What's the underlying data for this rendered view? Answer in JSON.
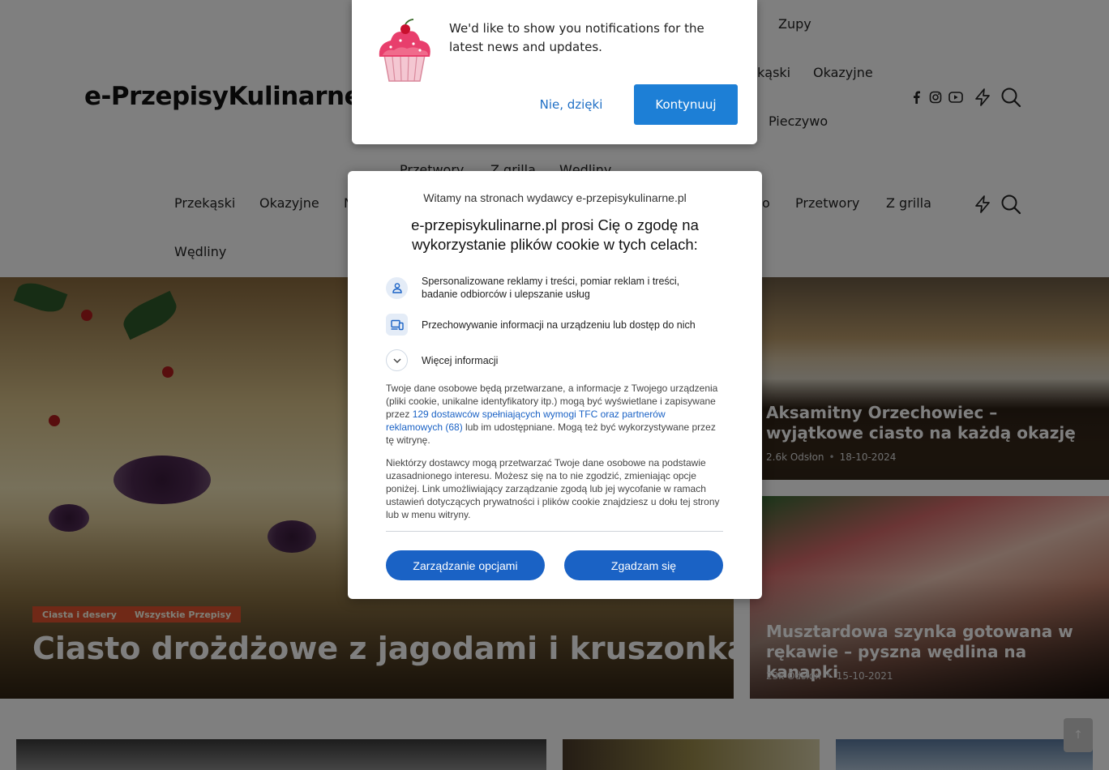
{
  "header": {
    "logo": "e-PrzepisyKulinarne.",
    "nav_top": [
      {
        "label": "Zupy"
      },
      {
        "label": "kąski"
      },
      {
        "label": "Okazyjne"
      },
      {
        "label": "Pieczywo"
      },
      {
        "label": "Przetwory"
      },
      {
        "label": "Z grilla"
      },
      {
        "label": "Wędliny"
      }
    ],
    "nav_sticky": [
      {
        "label": "Przekąski"
      },
      {
        "label": "Okazyjne"
      },
      {
        "label": "N"
      },
      {
        "label": "o"
      },
      {
        "label": "Przetwory"
      },
      {
        "label": "Z grilla"
      },
      {
        "label": "Wędliny"
      }
    ],
    "icons": [
      "facebook-icon",
      "instagram-icon",
      "youtube-icon",
      "lightning-icon",
      "search-icon"
    ]
  },
  "hero": {
    "categories": [
      "Ciasta i desery",
      "Wszystkie Przepisy"
    ],
    "title": "Ciasto drożdżowe z jagodami i kruszonką"
  },
  "side_cards": [
    {
      "title": "Aksamitny Orzechowiec – wyjątkowe ciasto na każdą okazję",
      "views": "2.6k Odsłon",
      "date": "18-10-2024"
    },
    {
      "title": "Musztardowa szynka gotowana w rękawie – pyszna wędlina na kanapki",
      "views": "23k Odsłon",
      "date": "15-10-2021"
    }
  ],
  "scroll_top_icon": "arrow-up-icon",
  "notification": {
    "message": "We'd like to show you notifications for the latest news and updates.",
    "decline": "Nie, dzięki",
    "accept": "Kontynuuj",
    "icon": "cupcake-icon"
  },
  "consent": {
    "welcome": "Witamy na stronach wydawcy e-przepisykulinarne.pl",
    "heading": "e-przepisykulinarne.pl prosi Cię o zgodę na wykorzystanie plików cookie w tych celach:",
    "purposes": [
      {
        "label": "Spersonalizowane reklamy i treści, pomiar reklam i treści, badanie odbiorców i ulepszanie usług",
        "icon": "person-icon"
      },
      {
        "label": "Przechowywanie informacji na urządzeniu lub dostęp do nich",
        "icon": "devices-icon"
      },
      {
        "label": "Więcej informacji",
        "icon": "chevron-down-icon"
      }
    ],
    "para1_start": "Twoje dane osobowe będą przetwarzane, a informacje z Twojego urządzenia (pliki cookie, unikalne identyfikatory itp.) mogą być wyświetlane i zapisywane przez ",
    "para1_link": "129 dostawców spełniających wymogi TFC oraz partnerów reklamowych (68)",
    "para1_end": " lub im udostępniane. Mogą też być wykorzystywane przez tę witrynę.",
    "para2": "Niektórzy dostawcy mogą przetwarzać Twoje dane osobowe na podstawie uzasadnionego interesu. Możesz się na to nie zgodzić, zmieniając opcje poniżej. Link umożliwiający zarządzanie zgodą lub jej wycofanie w ramach ustawień dotyczących prywatności i plików cookie znajdziesz u dołu tej strony lub w menu witryny.",
    "manage": "Zarządzanie opcjami",
    "agree": "Zgadzam się"
  },
  "colors": {
    "accent": "#1a62c5",
    "notif_accept": "#1d7fd6",
    "badge": "#e0532f",
    "overlay": "rgba(0,0,0,0.5)"
  }
}
